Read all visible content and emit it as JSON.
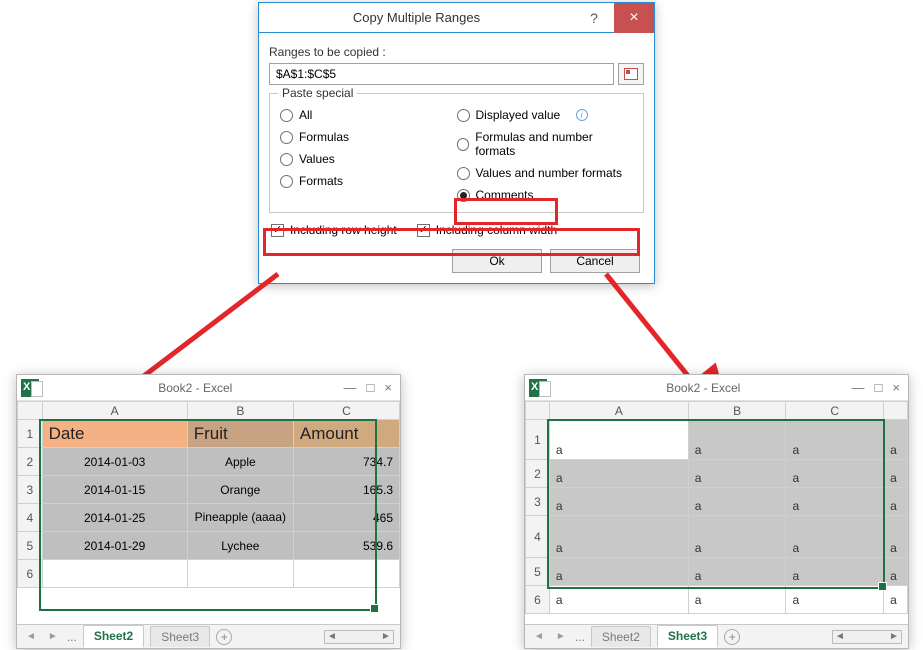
{
  "dialog": {
    "title": "Copy Multiple Ranges",
    "help": "?",
    "close": "×",
    "ranges_label": "Ranges to be copied :",
    "ranges_value": "$A$1:$C$5",
    "paste_special_legend": "Paste special",
    "options_left": [
      "All",
      "Formulas",
      "Values",
      "Formats"
    ],
    "options_right": [
      "Displayed value",
      "Formulas and number formats",
      "Values and number formats",
      "Comments"
    ],
    "info_i": "i",
    "chk_row": "Including row height",
    "chk_col": "Including column width",
    "ok": "Ok",
    "cancel": "Cancel",
    "checkmark": "✓"
  },
  "wb_left": {
    "title": "Book2 - Excel",
    "cols": [
      "A",
      "B",
      "C"
    ],
    "headers": {
      "date": "Date",
      "fruit": "Fruit",
      "amount": "Amount"
    },
    "rows": [
      {
        "date": "2014-01-03",
        "fruit": "Apple",
        "amount": "734.7"
      },
      {
        "date": "2014-01-15",
        "fruit": "Orange",
        "amount": "165.3"
      },
      {
        "date": "2014-01-25",
        "fruit": "Pineapple (aaaa)",
        "amount": "465"
      },
      {
        "date": "2014-01-29",
        "fruit": "Lychee",
        "amount": "539.6"
      }
    ],
    "rownums": [
      "1",
      "2",
      "3",
      "4",
      "5",
      "6"
    ],
    "tabs": {
      "sheet2": "Sheet2",
      "sheet3": "Sheet3",
      "ellipsis": "..."
    }
  },
  "wb_right": {
    "title": "Book2 - Excel",
    "cols": [
      "A",
      "B",
      "C"
    ],
    "cell": "a",
    "rownums": [
      "1",
      "2",
      "3",
      "4",
      "5",
      "6"
    ],
    "tabs": {
      "sheet2": "Sheet2",
      "sheet3": "Sheet3",
      "ellipsis": "..."
    }
  },
  "winbtns": {
    "min": "—",
    "max": "□",
    "close": "×"
  },
  "nav": {
    "left": "◄",
    "right": "►",
    "plus": "+"
  }
}
